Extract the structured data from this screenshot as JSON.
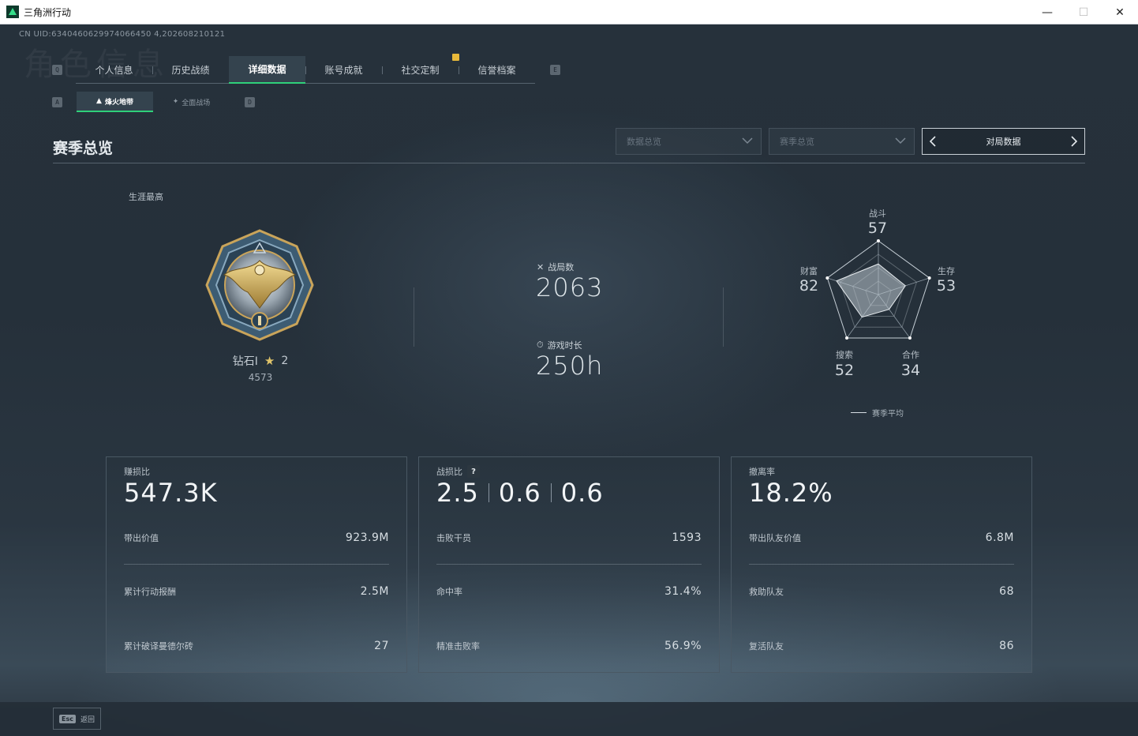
{
  "window": {
    "title": "三角洲行动"
  },
  "header": {
    "uid": "CN UID:6340460629974066450 4,202608210121",
    "ghost_name": "角色信息"
  },
  "hints": {
    "left_main": "Q",
    "right_main": "E",
    "left_sub": "A",
    "right_sub": "D"
  },
  "main_tabs": [
    {
      "label": "个人信息"
    },
    {
      "label": "历史战绩"
    },
    {
      "label": "详细数据",
      "active": true
    },
    {
      "label": "账号成就"
    },
    {
      "label": "社交定制"
    },
    {
      "label": "信誉档案"
    }
  ],
  "sub_tabs": [
    {
      "label": "烽火地带",
      "icon": "fire-zone-icon",
      "active": true
    },
    {
      "label": "全面战场",
      "icon": "battlefield-icon"
    }
  ],
  "section": {
    "title": "赛季总览",
    "dropdown1": "数据总览",
    "dropdown2": "赛季总览",
    "pager_label": "对局数据"
  },
  "rank": {
    "career_label": "生涯最高",
    "tier": "钻石I",
    "stars": "2",
    "score": "4573"
  },
  "stats": {
    "matches_label": "战局数",
    "matches_value": "2063",
    "playtime_label": "游戏时长",
    "playtime_value": "250h"
  },
  "radar": {
    "axes": [
      {
        "label": "战斗",
        "value": 57
      },
      {
        "label": "生存",
        "value": 53
      },
      {
        "label": "合作",
        "value": 34
      },
      {
        "label": "搜索",
        "value": 52
      },
      {
        "label": "财富",
        "value": 82
      }
    ],
    "values_text": {
      "combat": "57",
      "survival": "53",
      "cooperation": "34",
      "search": "52",
      "wealth": "82"
    },
    "labels": {
      "combat": "战斗",
      "survival": "生存",
      "cooperation": "合作",
      "search": "搜索",
      "wealth": "财富"
    },
    "legend": "赛季平均"
  },
  "cards": {
    "profit": {
      "title": "赚损比",
      "big": "547.3K",
      "rows": [
        {
          "k": "带出价值",
          "v": "923.9M"
        },
        {
          "k": "累计行动报酬",
          "v": "2.5M"
        },
        {
          "k": "累计破译曼德尔砖",
          "v": "27"
        }
      ]
    },
    "kd": {
      "title": "战损比",
      "help": "?",
      "big1": "2.5",
      "big2": "0.6",
      "big3": "0.6",
      "rows": [
        {
          "k": "击败干员",
          "v": "1593"
        },
        {
          "k": "命中率",
          "v": "31.4%"
        },
        {
          "k": "精准击败率",
          "v": "56.9%"
        }
      ]
    },
    "extract": {
      "title": "撤离率",
      "big": "18.2%",
      "rows": [
        {
          "k": "带出队友价值",
          "v": "6.8M"
        },
        {
          "k": "救助队友",
          "v": "68"
        },
        {
          "k": "复活队友",
          "v": "86"
        }
      ]
    }
  },
  "footer": {
    "esc_key": "Esc",
    "esc_label": "返回"
  },
  "colors": {
    "accent": "#2fd07a",
    "gold": "#e0c46a"
  }
}
